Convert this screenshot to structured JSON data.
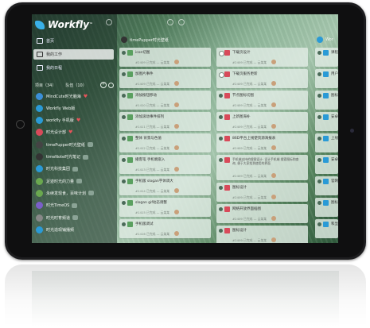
{
  "app": {
    "name": "Workfly",
    "trademark": "™"
  },
  "nav": [
    {
      "label": "首页",
      "active": false
    },
    {
      "label": "我的工作",
      "active": true
    },
    {
      "label": "我的日程",
      "active": false
    }
  ],
  "projects_header": {
    "projects_tab": "项目（34）",
    "teams_tab": "队伍（10）"
  },
  "projects": [
    {
      "name": "MindCute时光脑海",
      "color": "#3b8fd8",
      "heart": true
    },
    {
      "name": "Workfly Web版",
      "color": "#2a9ad6",
      "heart": false
    },
    {
      "name": "workfly 手机版",
      "color": "#2a9ad6",
      "heart": true
    },
    {
      "name": "时光设计部",
      "color": "#d84a5a",
      "heart": true
    },
    {
      "name": "timePupper时光壁纸",
      "color": "#444444",
      "heart": false
    },
    {
      "name": "timeNote时光笔记",
      "color": "#333333",
      "heart": false
    },
    {
      "name": "时光科技集团",
      "color": "#2a9ad6",
      "heart": false
    },
    {
      "name": "足迹时光的力量",
      "color": "#6aa84f",
      "heart": false
    },
    {
      "name": "永续发现食，百味计划",
      "color": "#6aa84f",
      "heart": false
    },
    {
      "name": "时光TimeOS",
      "color": "#7a5fc8",
      "heart": false
    },
    {
      "name": "时光时育频道",
      "color": "#888888",
      "heart": false
    },
    {
      "name": "时光造现铺播频",
      "color": "#2a9ad6",
      "heart": false
    }
  ],
  "columns": [
    {
      "title": "timePupper时光壁纸",
      "cards": [
        {
          "title": "icon切图",
          "meta": "#2409 已完成 — 云某某",
          "done": true,
          "thumb": "#5aa060"
        },
        {
          "title": "加图片事件",
          "meta": "#1409 已完成 — 云某某",
          "done": true,
          "thumb": "#5aa060"
        },
        {
          "title": "添加按钮移动",
          "meta": "#1410 已完成 — 云某某",
          "done": true,
          "thumb": "#5aa060"
        },
        {
          "title": "添加滚动事件排列",
          "meta": "#1411 已完成 — 云某某",
          "done": true,
          "thumb": "#5aa060"
        },
        {
          "title": "整体 背景与色值",
          "meta": "#1412 已完成 — 云某某",
          "done": true,
          "thumb": "#5aa060"
        },
        {
          "title": "播客笔 手机端嵌入",
          "meta": "#1413 已完成 — 云某某",
          "done": true,
          "thumb": "#5aa060"
        },
        {
          "title": "手机版 slogan字体调大",
          "meta": "#1414 已完成 — 云某某",
          "done": true,
          "thumb": "#5aa060"
        },
        {
          "title": "slogan gif动态调整",
          "meta": "#1415 已完成 — 云某某",
          "done": true,
          "thumb": "#5aa060"
        },
        {
          "title": "手机版调试",
          "meta": "#1416 已完成 — 云某某",
          "done": true,
          "thumb": "#5aa060"
        }
      ]
    },
    {
      "title": "",
      "cards": [
        {
          "title": "下载页设计",
          "meta": "#2409 已完成 — 云某某",
          "done": false,
          "thumb": "#d84a5a"
        },
        {
          "title": "下载页服务更新",
          "meta": "#2409 已完成 — 云某某",
          "done": false,
          "thumb": "#d84a5a"
        },
        {
          "title": "节点图标切图",
          "meta": "#2409 已完成 — 云某某",
          "done": true,
          "thumb": "#d84a5a"
        },
        {
          "title": "上新图海补",
          "meta": "#2409 已完成 — 云某某",
          "done": true,
          "thumb": "#d84a5a"
        },
        {
          "title": "86D平台上线使资源海报表",
          "meta": "#2409 已完成 — 云某某",
          "done": true,
          "thumb": "#d84a5a"
        },
        {
          "title": "手机端支持的搜图设计: 设计手机端 搜索图标和查询, 便于大家找到使用的界面",
          "meta": "#2409 已完成 — 云某某",
          "done": true,
          "thumb": "#d84a5a"
        },
        {
          "title": "图标设计",
          "meta": "#2409 已完成 — 云某某",
          "done": true,
          "thumb": "#d84a5a"
        },
        {
          "title": "网络开放界面插图",
          "meta": "#2409 已完成 — 云某某",
          "done": true,
          "thumb": "#d84a5a"
        },
        {
          "title": "图标设计",
          "meta": "#2409 已完成 — 云某某",
          "done": true,
          "thumb": "#d84a5a"
        }
      ]
    },
    {
      "title": "Wor",
      "cards": [
        {
          "title": "课程图标",
          "done": true,
          "thumb": "#2a9ad6"
        },
        {
          "title": "用户...",
          "done": true,
          "thumb": "#2a9ad6"
        },
        {
          "title": "图标...",
          "done": true,
          "thumb": "#2a9ad6"
        },
        {
          "title": "安卓上...",
          "done": true,
          "thumb": "#2a9ad6"
        },
        {
          "title": "上线图",
          "done": true,
          "thumb": "#2a9ad6"
        },
        {
          "title": "安卓...",
          "done": true,
          "thumb": "#2a9ad6"
        },
        {
          "title": "官网...",
          "done": true,
          "thumb": "#2a9ad6"
        },
        {
          "title": "图标...",
          "done": true,
          "thumb": "#2a9ad6"
        },
        {
          "title": "和显...",
          "done": true,
          "thumb": "#2a9ad6"
        }
      ]
    }
  ]
}
